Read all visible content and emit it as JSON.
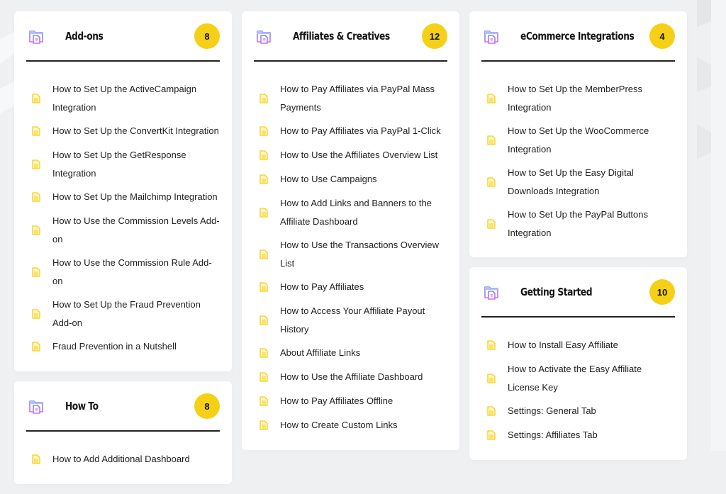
{
  "colors": {
    "badge": "#f5d016",
    "doc_icon": "#f5d016",
    "folder_icon_top": "#7b8cf7",
    "folder_icon_bottom": "#c86ff0",
    "divider": "#222222"
  },
  "categories": [
    {
      "title": "Add-ons",
      "count": "8",
      "icon": "folder-document-icon",
      "articles": [
        "How to Set Up the ActiveCampaign Integration",
        "How to Set Up the ConvertKit Integration",
        "How to Set Up the GetResponse Integration",
        "How to Set Up the Mailchimp Integration",
        "How to Use the Commission Levels Add-on",
        "How to Use the Commission Rule Add-on",
        "How to Set Up the Fraud Prevention Add-on",
        "Fraud Prevention in a Nutshell"
      ]
    },
    {
      "title": "How To",
      "count": "8",
      "icon": "folder-document-icon",
      "articles": [
        "How to Add Additional Dashboard"
      ]
    },
    {
      "title": "Affiliates & Creatives",
      "count": "12",
      "icon": "folder-document-icon",
      "articles": [
        "How to Pay Affiliates via PayPal Mass Payments",
        "How to Pay Affiliates via PayPal 1-Click",
        "How to Use the Affiliates Overview List",
        "How to Use Campaigns",
        "How to Add Links and Banners to the Affiliate Dashboard",
        "How to Use the Transactions Overview List",
        "How to Pay Affiliates",
        "How to Access Your Affiliate Payout History",
        "About Affiliate Links",
        "How to Use the Affiliate Dashboard",
        "How to Pay Affiliates Offline",
        "How to Create Custom Links"
      ]
    },
    {
      "title": "eCommerce Integrations",
      "count": "4",
      "icon": "folder-document-icon",
      "articles": [
        "How to Set Up the MemberPress Integration",
        "How to Set Up the WooCommerce Integration",
        "How to Set Up the Easy Digital Downloads Integration",
        "How to Set Up the PayPal Buttons Integration"
      ]
    },
    {
      "title": "Getting Started",
      "count": "10",
      "icon": "folder-document-icon",
      "articles": [
        "How to Install Easy Affiliate",
        "How to Activate the Easy Affiliate License Key",
        "Settings: General Tab",
        "Settings: Affiliates Tab"
      ]
    }
  ]
}
